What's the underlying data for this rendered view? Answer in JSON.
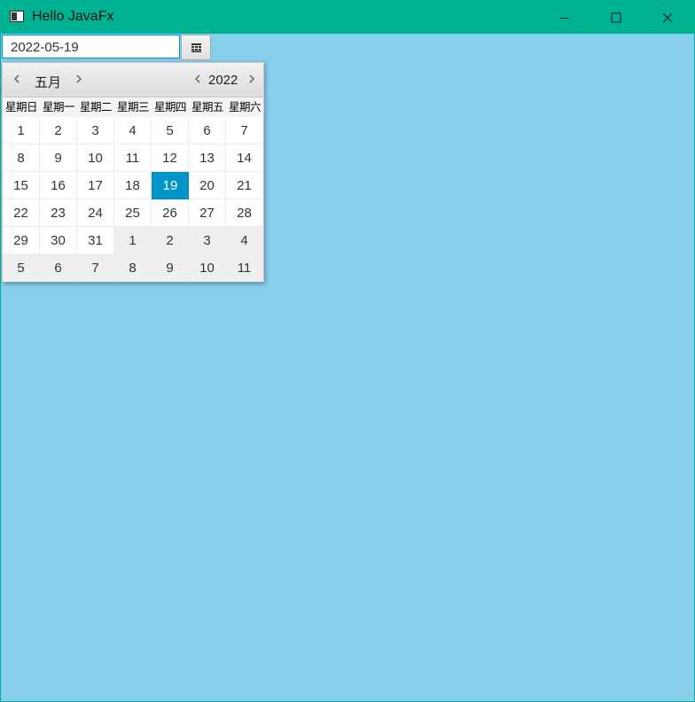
{
  "window": {
    "title": "Hello JavaFx",
    "accent_color": "#00b294",
    "background_color": "#87ceeb"
  },
  "date_picker": {
    "value": "2022-05-19",
    "button_icon": "calendar-grid-icon"
  },
  "calendar": {
    "month": "五月",
    "year": "2022",
    "weekdays": [
      "星期日",
      "星期一",
      "星期二",
      "星期三",
      "星期四",
      "星期五",
      "星期六"
    ],
    "weeks": [
      [
        "1",
        "2",
        "3",
        "4",
        "5",
        "6",
        "7"
      ],
      [
        "8",
        "9",
        "10",
        "11",
        "12",
        "13",
        "14"
      ],
      [
        "15",
        "16",
        "17",
        "18",
        "19",
        "20",
        "21"
      ],
      [
        "22",
        "23",
        "24",
        "25",
        "26",
        "27",
        "28"
      ],
      [
        "29",
        "30",
        "31",
        "1",
        "2",
        "3",
        "4"
      ],
      [
        "5",
        "6",
        "7",
        "8",
        "9",
        "10",
        "11"
      ]
    ],
    "selected_day": "19",
    "selected_color": "#0096c9"
  }
}
